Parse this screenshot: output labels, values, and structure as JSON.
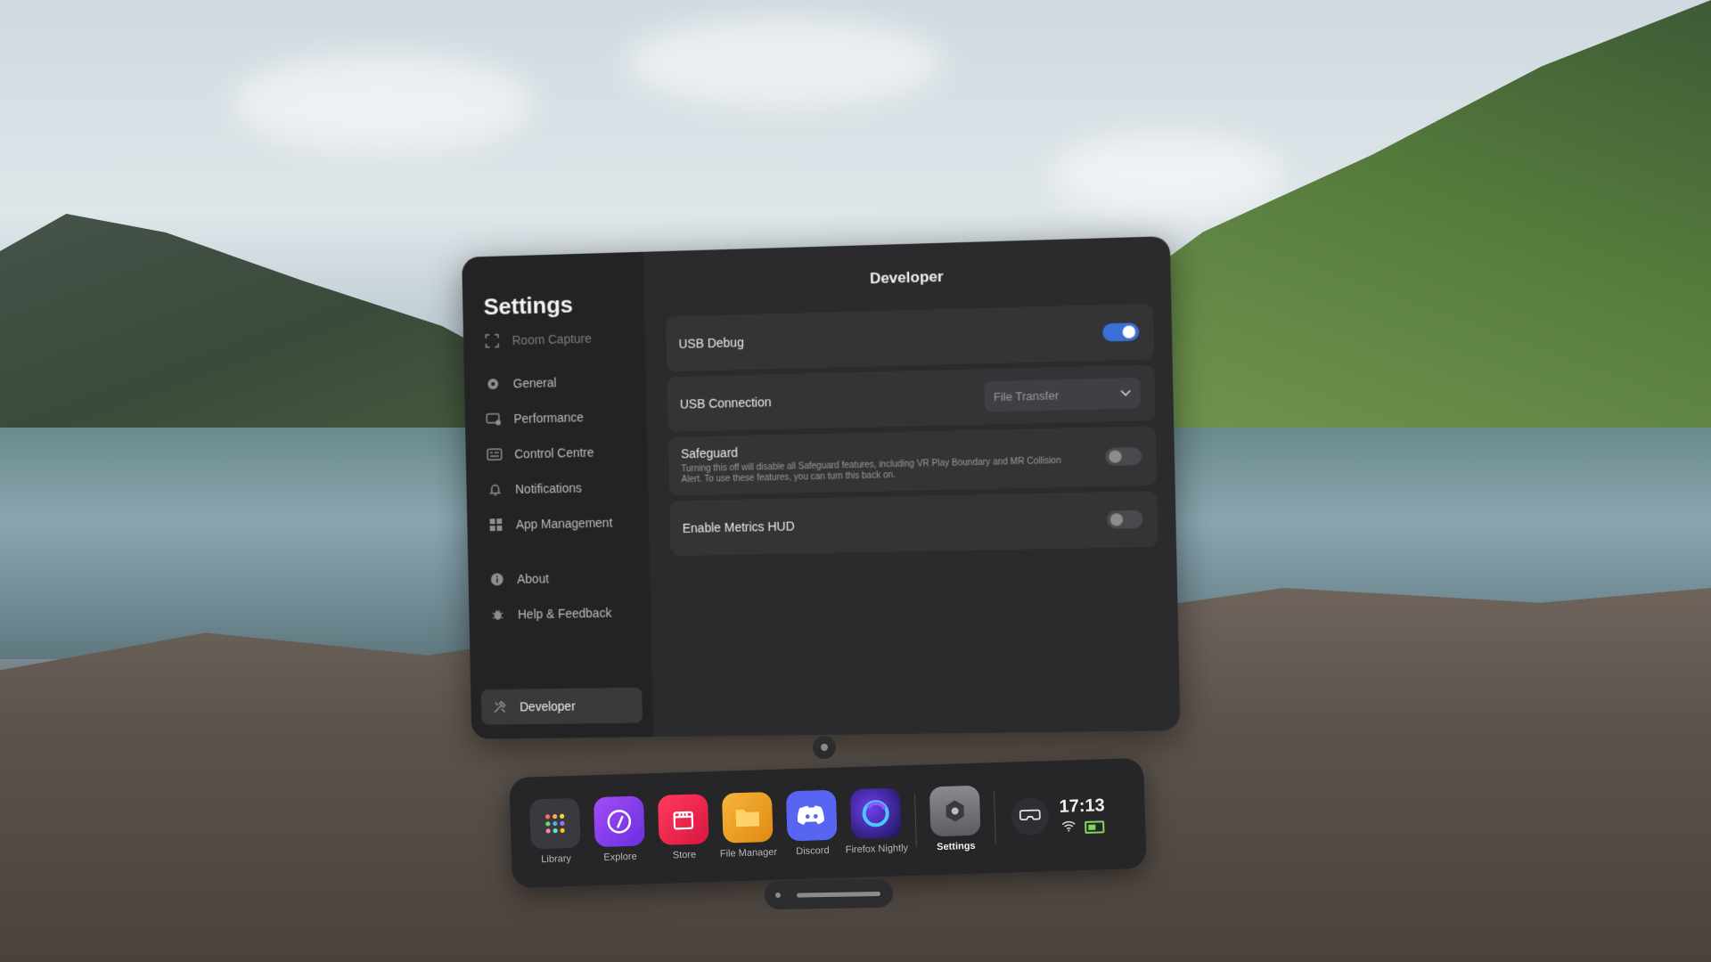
{
  "settings": {
    "title": "Settings",
    "sidebar": {
      "items": [
        {
          "label": "Room Capture",
          "icon": "room-capture-icon"
        },
        {
          "label": "General",
          "icon": "gear-icon"
        },
        {
          "label": "Performance",
          "icon": "performance-icon"
        },
        {
          "label": "Control Centre",
          "icon": "control-centre-icon"
        },
        {
          "label": "Notifications",
          "icon": "bell-icon"
        },
        {
          "label": "App Management",
          "icon": "grid-icon"
        },
        {
          "label": "About",
          "icon": "info-icon"
        },
        {
          "label": "Help & Feedback",
          "icon": "bug-icon"
        },
        {
          "label": "Developer",
          "icon": "tools-icon"
        }
      ],
      "active": "Developer"
    },
    "page": {
      "title": "Developer",
      "usb_debug": {
        "label": "USB Debug",
        "enabled": true
      },
      "usb_connection": {
        "label": "USB Connection",
        "value": "File Transfer"
      },
      "safeguard": {
        "label": "Safeguard",
        "description": "Turning this off will disable all Safeguard features, including VR Play Boundary and MR Collision Alert. To use these features, you can turn this back on.",
        "enabled": false
      },
      "metrics_hud": {
        "label": "Enable Metrics HUD",
        "enabled": false
      }
    }
  },
  "dock": {
    "apps": [
      {
        "label": "Library",
        "icon": "library-grid-icon",
        "color": "#3a3a3e"
      },
      {
        "label": "Explore",
        "icon": "compass-icon",
        "color": "#8b3cf0"
      },
      {
        "label": "Store",
        "icon": "store-icon",
        "color": "#e8264e"
      },
      {
        "label": "File Manager",
        "icon": "folder-icon",
        "color": "#e8a21f"
      },
      {
        "label": "Discord",
        "icon": "discord-icon",
        "color": "#5865f2"
      },
      {
        "label": "Firefox Nightly",
        "icon": "firefox-nightly-icon",
        "color": "#2a1f6b"
      },
      {
        "label": "Settings",
        "icon": "settings-hex-icon",
        "color": "#6f6f74",
        "selected": true
      }
    ],
    "clock": "17:13",
    "accent": "#3b6fd6"
  }
}
